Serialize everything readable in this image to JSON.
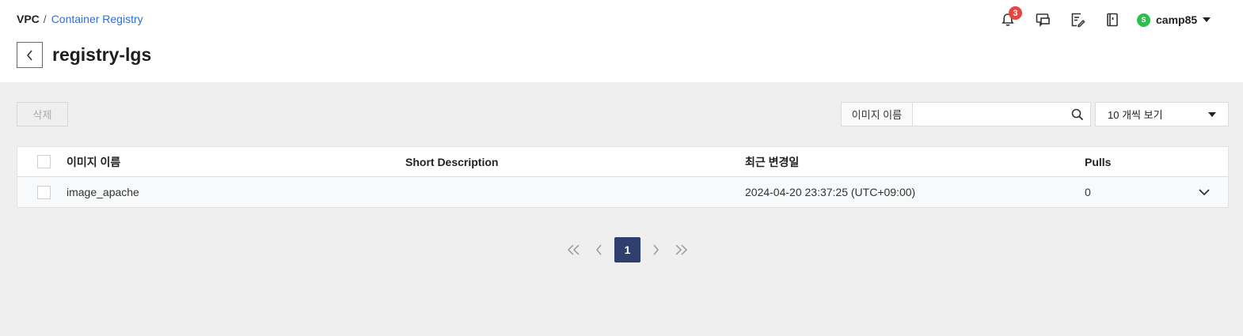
{
  "breadcrumb": {
    "root": "VPC",
    "separator": "/",
    "current": "Container Registry"
  },
  "page": {
    "title": "registry-lgs"
  },
  "header": {
    "notification_count": "3",
    "user": {
      "initial": "S",
      "name": "camp85",
      "avatar_color": "#2cbf4e"
    }
  },
  "toolbar": {
    "delete_label": "삭제",
    "search_label": "이미지 이름",
    "search_value": "",
    "page_size_label": "10 개씩 보기"
  },
  "table": {
    "columns": [
      "이미지 이름",
      "Short Description",
      "최근 변경일",
      "Pulls"
    ],
    "rows": [
      {
        "name": "image_apache",
        "description": "",
        "updated": "2024-04-20 23:37:25 (UTC+09:00)",
        "pulls": "0"
      }
    ]
  },
  "pagination": {
    "current_page": "1"
  },
  "colors": {
    "accent": "#2f6fd0",
    "pager_active": "#2e3f6e",
    "badge": "#e8453c"
  }
}
